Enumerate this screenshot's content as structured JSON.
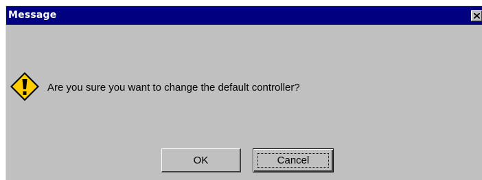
{
  "dialog": {
    "title": "Message",
    "message": "Are you sure you want to change the default controller?",
    "icon": "warning-icon",
    "buttons": {
      "ok_label": "OK",
      "cancel_label": "Cancel"
    }
  },
  "colors": {
    "titlebar": "#000080",
    "dialog_background": "#c0c0c0",
    "warning_fill": "#ffcc00"
  }
}
